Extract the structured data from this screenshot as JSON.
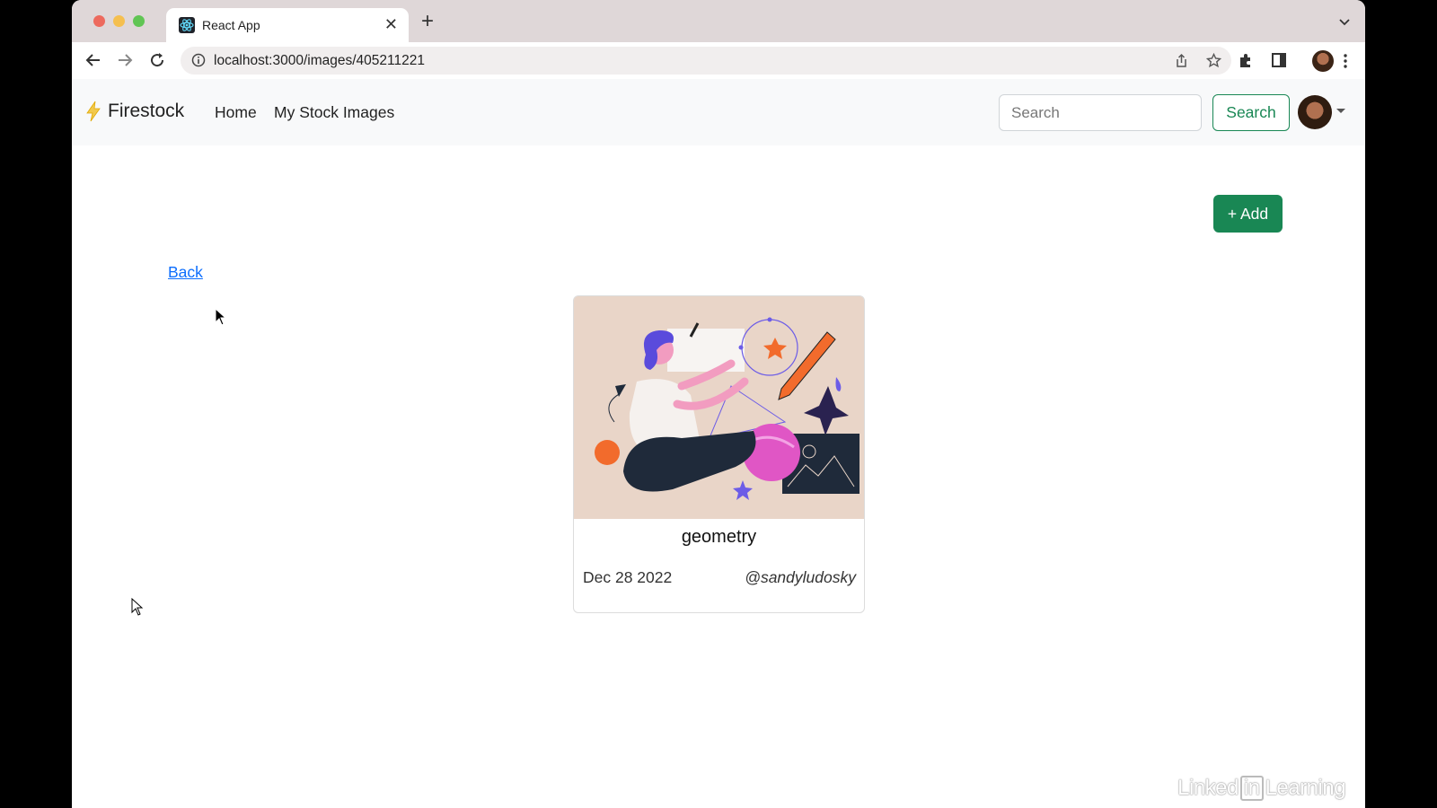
{
  "browser": {
    "tab_title": "React App",
    "tab_close": "✕",
    "new_tab": "+",
    "url": "localhost:3000/images/405211221"
  },
  "navbar": {
    "brand": "Firestock",
    "links": [
      "Home",
      "My Stock Images"
    ],
    "search_placeholder": "Search",
    "search_button": "Search"
  },
  "page": {
    "add_button": "+ Add",
    "back_link": "Back"
  },
  "card": {
    "title": "geometry",
    "date": "Dec 28 2022",
    "user": "@sandyludosky"
  },
  "watermark": {
    "left": "Linked",
    "mid": "in",
    "right": "Learning"
  },
  "colors": {
    "primary_green": "#198754",
    "link_blue": "#0d6efd",
    "navbar_bg": "#f8f9fa",
    "card_image_bg": "#e9d5c8"
  }
}
